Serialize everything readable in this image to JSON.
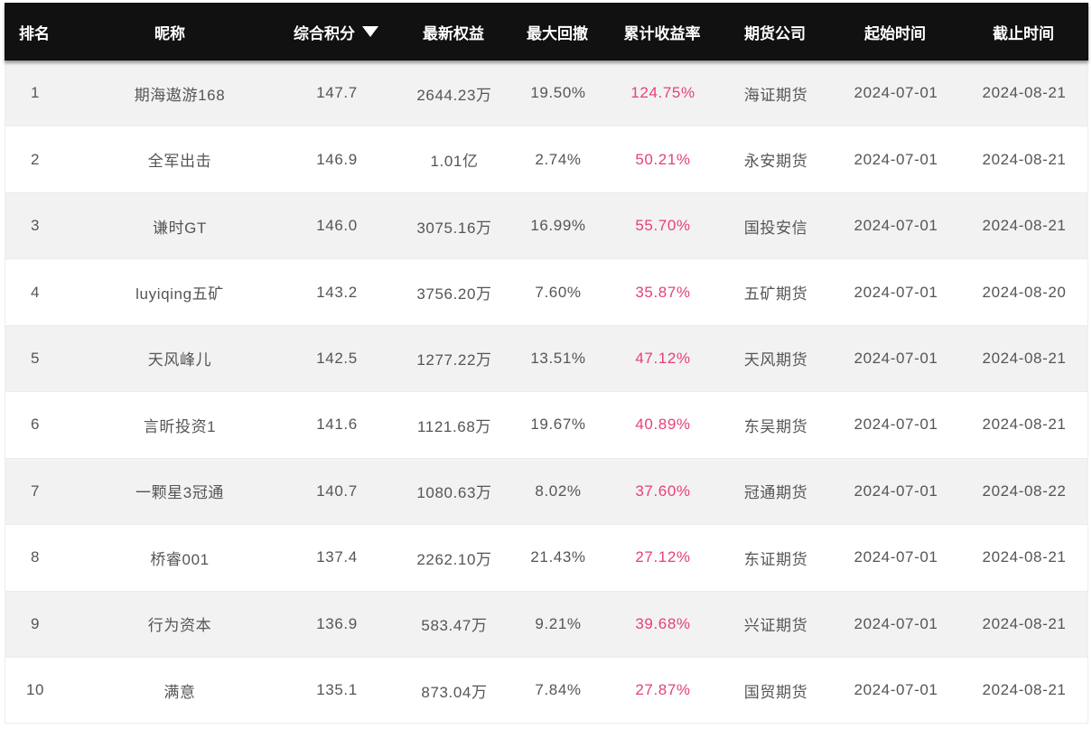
{
  "table": {
    "headers": {
      "rank": "排名",
      "nickname": "昵称",
      "score": "综合积分",
      "equity": "最新权益",
      "drawdown": "最大回撤",
      "return": "累计收益率",
      "company": "期货公司",
      "start": "起始时间",
      "end": "截止时间",
      "score_sort_icon": "sort-desc-icon"
    },
    "rows": [
      {
        "rank": "1",
        "nickname": "期海遨游168",
        "score": "147.7",
        "equity": "2644.23万",
        "drawdown": "19.50%",
        "return": "124.75%",
        "company": "海证期货",
        "start": "2024-07-01",
        "end": "2024-08-21"
      },
      {
        "rank": "2",
        "nickname": "全军出击",
        "score": "146.9",
        "equity": "1.01亿",
        "drawdown": "2.74%",
        "return": "50.21%",
        "company": "永安期货",
        "start": "2024-07-01",
        "end": "2024-08-21"
      },
      {
        "rank": "3",
        "nickname": "谦时GT",
        "score": "146.0",
        "equity": "3075.16万",
        "drawdown": "16.99%",
        "return": "55.70%",
        "company": "国投安信",
        "start": "2024-07-01",
        "end": "2024-08-21"
      },
      {
        "rank": "4",
        "nickname": "luyiqing五矿",
        "score": "143.2",
        "equity": "3756.20万",
        "drawdown": "7.60%",
        "return": "35.87%",
        "company": "五矿期货",
        "start": "2024-07-01",
        "end": "2024-08-20"
      },
      {
        "rank": "5",
        "nickname": "天风峰儿",
        "score": "142.5",
        "equity": "1277.22万",
        "drawdown": "13.51%",
        "return": "47.12%",
        "company": "天风期货",
        "start": "2024-07-01",
        "end": "2024-08-21"
      },
      {
        "rank": "6",
        "nickname": "言昕投资1",
        "score": "141.6",
        "equity": "1121.68万",
        "drawdown": "19.67%",
        "return": "40.89%",
        "company": "东吴期货",
        "start": "2024-07-01",
        "end": "2024-08-21"
      },
      {
        "rank": "7",
        "nickname": "一颗星3冠通",
        "score": "140.7",
        "equity": "1080.63万",
        "drawdown": "8.02%",
        "return": "37.60%",
        "company": "冠通期货",
        "start": "2024-07-01",
        "end": "2024-08-22"
      },
      {
        "rank": "8",
        "nickname": "桥睿001",
        "score": "137.4",
        "equity": "2262.10万",
        "drawdown": "21.43%",
        "return": "27.12%",
        "company": "东证期货",
        "start": "2024-07-01",
        "end": "2024-08-21"
      },
      {
        "rank": "9",
        "nickname": "行为资本",
        "score": "136.9",
        "equity": "583.47万",
        "drawdown": "9.21%",
        "return": "39.68%",
        "company": "兴证期货",
        "start": "2024-07-01",
        "end": "2024-08-21"
      },
      {
        "rank": "10",
        "nickname": "满意",
        "score": "135.1",
        "equity": "873.04万",
        "drawdown": "7.84%",
        "return": "27.87%",
        "company": "国贸期货",
        "start": "2024-07-01",
        "end": "2024-08-21"
      }
    ]
  },
  "colors": {
    "header_bg": "#111111",
    "header_text": "#ffffff",
    "row_alt_bg": "#f2f2f2",
    "row_bg": "#ffffff",
    "body_text": "#555555",
    "return_text": "#e6407c"
  }
}
